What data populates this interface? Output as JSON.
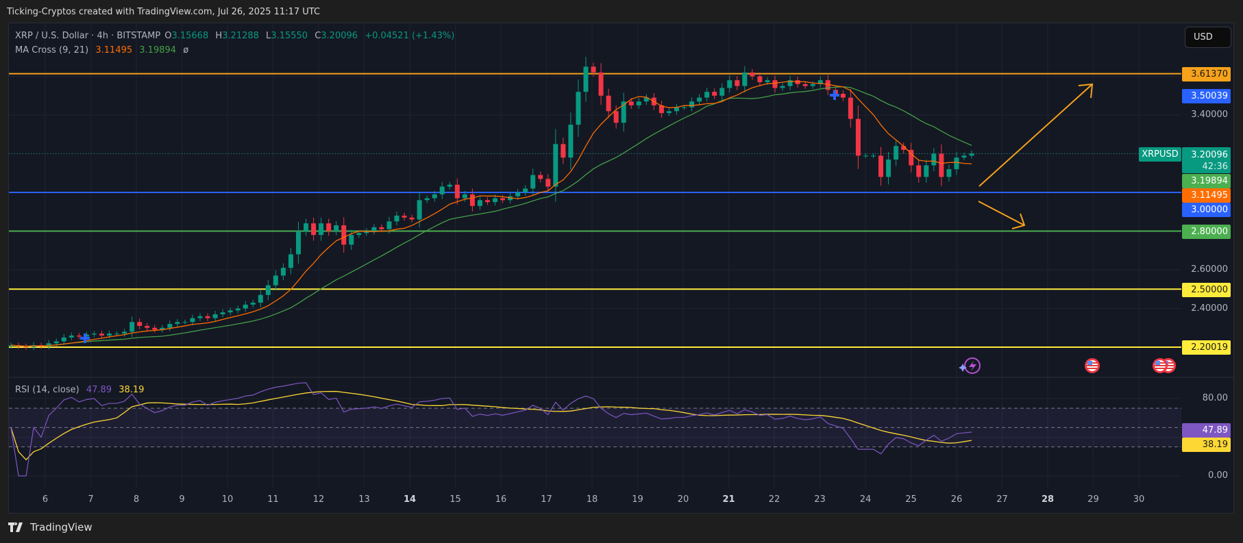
{
  "credit": "Ticking-Cryptos created with TradingView.com, Jul 26, 2025 11:17 UTC",
  "legend": {
    "symbol": "XRP / U.S. Dollar · 4h · BITSTAMP",
    "o_label": "O",
    "o": "3.15668",
    "h_label": "H",
    "h": "3.21288",
    "l_label": "L",
    "l": "3.15550",
    "c_label": "C",
    "c": "3.20096",
    "change": "+0.04521 (+1.43%)",
    "ma_name": "MA Cross (9, 21)",
    "ma_fast": "3.11495",
    "ma_slow": "3.19894",
    "ma_flag": "ø"
  },
  "rsi_legend": {
    "name": "RSI (14, close)",
    "rsi": "47.89",
    "rsi_ma": "38.19"
  },
  "currency_button": "USD",
  "symbol_tag": "XRPUSD",
  "countdown": "42:36",
  "price_labels": {
    "l3613": "3.61370",
    "l3500": "3.50039",
    "l3400": "3.40000",
    "current": "3.20096",
    "ma_slow": "3.19894",
    "ma_fast": "3.11495",
    "l3000": "3.00000",
    "l2800": "2.80000",
    "l2600": "2.60000",
    "l2500": "2.50000",
    "l2400": "2.40000",
    "l2200": "2.20019"
  },
  "rsi_labels": {
    "top": "80.00",
    "rsi": "47.89",
    "rsi_ma": "38.19",
    "bottom": "0.00"
  },
  "dates": [
    {
      "t": "6"
    },
    {
      "t": "7"
    },
    {
      "t": "8"
    },
    {
      "t": "9"
    },
    {
      "t": "10"
    },
    {
      "t": "11"
    },
    {
      "t": "12"
    },
    {
      "t": "13"
    },
    {
      "t": "14",
      "bold": true
    },
    {
      "t": "15"
    },
    {
      "t": "16"
    },
    {
      "t": "17"
    },
    {
      "t": "18"
    },
    {
      "t": "19"
    },
    {
      "t": "20"
    },
    {
      "t": "21",
      "bold": true
    },
    {
      "t": "22"
    },
    {
      "t": "23"
    },
    {
      "t": "24"
    },
    {
      "t": "25"
    },
    {
      "t": "26"
    },
    {
      "t": "27"
    },
    {
      "t": "28",
      "bold": true
    },
    {
      "t": "29"
    },
    {
      "t": "30"
    }
  ],
  "brand": "TradingView",
  "colors": {
    "up": "#089981",
    "down": "#f23645",
    "ma_fast": "#ff6d00",
    "ma_slow": "#43a047",
    "rsi": "#7e57c2",
    "rsi_ma": "#fdd835"
  },
  "chart_data": {
    "type": "candlestick",
    "title": "XRP / U.S. Dollar · 4h · BITSTAMP",
    "ylim": [
      2.15,
      3.72
    ],
    "x_ticks": [
      "6",
      "7",
      "8",
      "9",
      "10",
      "11",
      "12",
      "13",
      "14",
      "15",
      "16",
      "17",
      "18",
      "19",
      "20",
      "21",
      "22",
      "23",
      "24",
      "25",
      "26",
      "27",
      "28",
      "29",
      "30"
    ],
    "closes": [
      2.21,
      2.205,
      2.2,
      2.21,
      2.205,
      2.22,
      2.23,
      2.25,
      2.26,
      2.255,
      2.265,
      2.27,
      2.26,
      2.27,
      2.27,
      2.28,
      2.33,
      2.31,
      2.3,
      2.29,
      2.3,
      2.32,
      2.33,
      2.33,
      2.35,
      2.36,
      2.35,
      2.37,
      2.38,
      2.39,
      2.4,
      2.42,
      2.43,
      2.47,
      2.52,
      2.57,
      2.61,
      2.68,
      2.8,
      2.84,
      2.78,
      2.84,
      2.8,
      2.83,
      2.73,
      2.78,
      2.79,
      2.8,
      2.82,
      2.81,
      2.85,
      2.88,
      2.87,
      2.86,
      2.96,
      2.97,
      2.99,
      3.03,
      3.04,
      2.97,
      2.99,
      2.93,
      2.96,
      2.95,
      2.97,
      2.96,
      2.98,
      3.0,
      3.02,
      3.09,
      3.07,
      3.03,
      3.25,
      3.18,
      3.35,
      3.52,
      3.65,
      3.62,
      3.5,
      3.42,
      3.36,
      3.47,
      3.45,
      3.47,
      3.49,
      3.45,
      3.41,
      3.42,
      3.44,
      3.44,
      3.47,
      3.49,
      3.52,
      3.5,
      3.54,
      3.58,
      3.55,
      3.62,
      3.6,
      3.57,
      3.58,
      3.54,
      3.55,
      3.58,
      3.56,
      3.55,
      3.56,
      3.58,
      3.53,
      3.51,
      3.49,
      3.38,
      3.19,
      3.19,
      3.19,
      3.08,
      3.17,
      3.24,
      3.22,
      3.14,
      3.08,
      3.14,
      3.2,
      3.08,
      3.12,
      3.18,
      3.19,
      3.20096
    ],
    "horizontal_levels": [
      {
        "value": 3.6137,
        "color": "#f7a21b"
      },
      {
        "value": 3.0,
        "color": "#2962ff"
      },
      {
        "value": 2.8,
        "color": "#4caf50"
      },
      {
        "value": 2.5,
        "color": "#ffeb3b"
      },
      {
        "value": 2.20019,
        "color": "#ffeb3b"
      }
    ],
    "indicators": [
      "MA 9",
      "MA 21",
      "RSI 14",
      "RSI MA 14"
    ],
    "rsi_bands": [
      30,
      50,
      70
    ],
    "rsi_axis": [
      0,
      80
    ]
  }
}
